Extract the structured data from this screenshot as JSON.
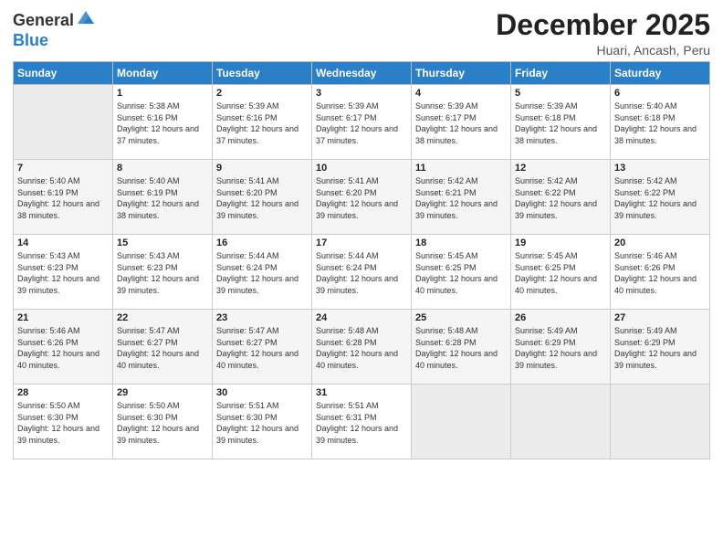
{
  "header": {
    "logo_general": "General",
    "logo_blue": "Blue",
    "month_title": "December 2025",
    "location": "Huari, Ancash, Peru"
  },
  "days_of_week": [
    "Sunday",
    "Monday",
    "Tuesday",
    "Wednesday",
    "Thursday",
    "Friday",
    "Saturday"
  ],
  "weeks": [
    [
      {
        "day": "",
        "sunrise": "",
        "sunset": "",
        "daylight": "",
        "empty": true
      },
      {
        "day": "1",
        "sunrise": "Sunrise: 5:38 AM",
        "sunset": "Sunset: 6:16 PM",
        "daylight": "Daylight: 12 hours and 37 minutes."
      },
      {
        "day": "2",
        "sunrise": "Sunrise: 5:39 AM",
        "sunset": "Sunset: 6:16 PM",
        "daylight": "Daylight: 12 hours and 37 minutes."
      },
      {
        "day": "3",
        "sunrise": "Sunrise: 5:39 AM",
        "sunset": "Sunset: 6:17 PM",
        "daylight": "Daylight: 12 hours and 37 minutes."
      },
      {
        "day": "4",
        "sunrise": "Sunrise: 5:39 AM",
        "sunset": "Sunset: 6:17 PM",
        "daylight": "Daylight: 12 hours and 38 minutes."
      },
      {
        "day": "5",
        "sunrise": "Sunrise: 5:39 AM",
        "sunset": "Sunset: 6:18 PM",
        "daylight": "Daylight: 12 hours and 38 minutes."
      },
      {
        "day": "6",
        "sunrise": "Sunrise: 5:40 AM",
        "sunset": "Sunset: 6:18 PM",
        "daylight": "Daylight: 12 hours and 38 minutes."
      }
    ],
    [
      {
        "day": "7",
        "sunrise": "Sunrise: 5:40 AM",
        "sunset": "Sunset: 6:19 PM",
        "daylight": "Daylight: 12 hours and 38 minutes."
      },
      {
        "day": "8",
        "sunrise": "Sunrise: 5:40 AM",
        "sunset": "Sunset: 6:19 PM",
        "daylight": "Daylight: 12 hours and 38 minutes."
      },
      {
        "day": "9",
        "sunrise": "Sunrise: 5:41 AM",
        "sunset": "Sunset: 6:20 PM",
        "daylight": "Daylight: 12 hours and 39 minutes."
      },
      {
        "day": "10",
        "sunrise": "Sunrise: 5:41 AM",
        "sunset": "Sunset: 6:20 PM",
        "daylight": "Daylight: 12 hours and 39 minutes."
      },
      {
        "day": "11",
        "sunrise": "Sunrise: 5:42 AM",
        "sunset": "Sunset: 6:21 PM",
        "daylight": "Daylight: 12 hours and 39 minutes."
      },
      {
        "day": "12",
        "sunrise": "Sunrise: 5:42 AM",
        "sunset": "Sunset: 6:22 PM",
        "daylight": "Daylight: 12 hours and 39 minutes."
      },
      {
        "day": "13",
        "sunrise": "Sunrise: 5:42 AM",
        "sunset": "Sunset: 6:22 PM",
        "daylight": "Daylight: 12 hours and 39 minutes."
      }
    ],
    [
      {
        "day": "14",
        "sunrise": "Sunrise: 5:43 AM",
        "sunset": "Sunset: 6:23 PM",
        "daylight": "Daylight: 12 hours and 39 minutes."
      },
      {
        "day": "15",
        "sunrise": "Sunrise: 5:43 AM",
        "sunset": "Sunset: 6:23 PM",
        "daylight": "Daylight: 12 hours and 39 minutes."
      },
      {
        "day": "16",
        "sunrise": "Sunrise: 5:44 AM",
        "sunset": "Sunset: 6:24 PM",
        "daylight": "Daylight: 12 hours and 39 minutes."
      },
      {
        "day": "17",
        "sunrise": "Sunrise: 5:44 AM",
        "sunset": "Sunset: 6:24 PM",
        "daylight": "Daylight: 12 hours and 39 minutes."
      },
      {
        "day": "18",
        "sunrise": "Sunrise: 5:45 AM",
        "sunset": "Sunset: 6:25 PM",
        "daylight": "Daylight: 12 hours and 40 minutes."
      },
      {
        "day": "19",
        "sunrise": "Sunrise: 5:45 AM",
        "sunset": "Sunset: 6:25 PM",
        "daylight": "Daylight: 12 hours and 40 minutes."
      },
      {
        "day": "20",
        "sunrise": "Sunrise: 5:46 AM",
        "sunset": "Sunset: 6:26 PM",
        "daylight": "Daylight: 12 hours and 40 minutes."
      }
    ],
    [
      {
        "day": "21",
        "sunrise": "Sunrise: 5:46 AM",
        "sunset": "Sunset: 6:26 PM",
        "daylight": "Daylight: 12 hours and 40 minutes."
      },
      {
        "day": "22",
        "sunrise": "Sunrise: 5:47 AM",
        "sunset": "Sunset: 6:27 PM",
        "daylight": "Daylight: 12 hours and 40 minutes."
      },
      {
        "day": "23",
        "sunrise": "Sunrise: 5:47 AM",
        "sunset": "Sunset: 6:27 PM",
        "daylight": "Daylight: 12 hours and 40 minutes."
      },
      {
        "day": "24",
        "sunrise": "Sunrise: 5:48 AM",
        "sunset": "Sunset: 6:28 PM",
        "daylight": "Daylight: 12 hours and 40 minutes."
      },
      {
        "day": "25",
        "sunrise": "Sunrise: 5:48 AM",
        "sunset": "Sunset: 6:28 PM",
        "daylight": "Daylight: 12 hours and 40 minutes."
      },
      {
        "day": "26",
        "sunrise": "Sunrise: 5:49 AM",
        "sunset": "Sunset: 6:29 PM",
        "daylight": "Daylight: 12 hours and 39 minutes."
      },
      {
        "day": "27",
        "sunrise": "Sunrise: 5:49 AM",
        "sunset": "Sunset: 6:29 PM",
        "daylight": "Daylight: 12 hours and 39 minutes."
      }
    ],
    [
      {
        "day": "28",
        "sunrise": "Sunrise: 5:50 AM",
        "sunset": "Sunset: 6:30 PM",
        "daylight": "Daylight: 12 hours and 39 minutes."
      },
      {
        "day": "29",
        "sunrise": "Sunrise: 5:50 AM",
        "sunset": "Sunset: 6:30 PM",
        "daylight": "Daylight: 12 hours and 39 minutes."
      },
      {
        "day": "30",
        "sunrise": "Sunrise: 5:51 AM",
        "sunset": "Sunset: 6:30 PM",
        "daylight": "Daylight: 12 hours and 39 minutes."
      },
      {
        "day": "31",
        "sunrise": "Sunrise: 5:51 AM",
        "sunset": "Sunset: 6:31 PM",
        "daylight": "Daylight: 12 hours and 39 minutes."
      },
      {
        "day": "",
        "sunrise": "",
        "sunset": "",
        "daylight": "",
        "empty": true
      },
      {
        "day": "",
        "sunrise": "",
        "sunset": "",
        "daylight": "",
        "empty": true
      },
      {
        "day": "",
        "sunrise": "",
        "sunset": "",
        "daylight": "",
        "empty": true
      }
    ]
  ]
}
